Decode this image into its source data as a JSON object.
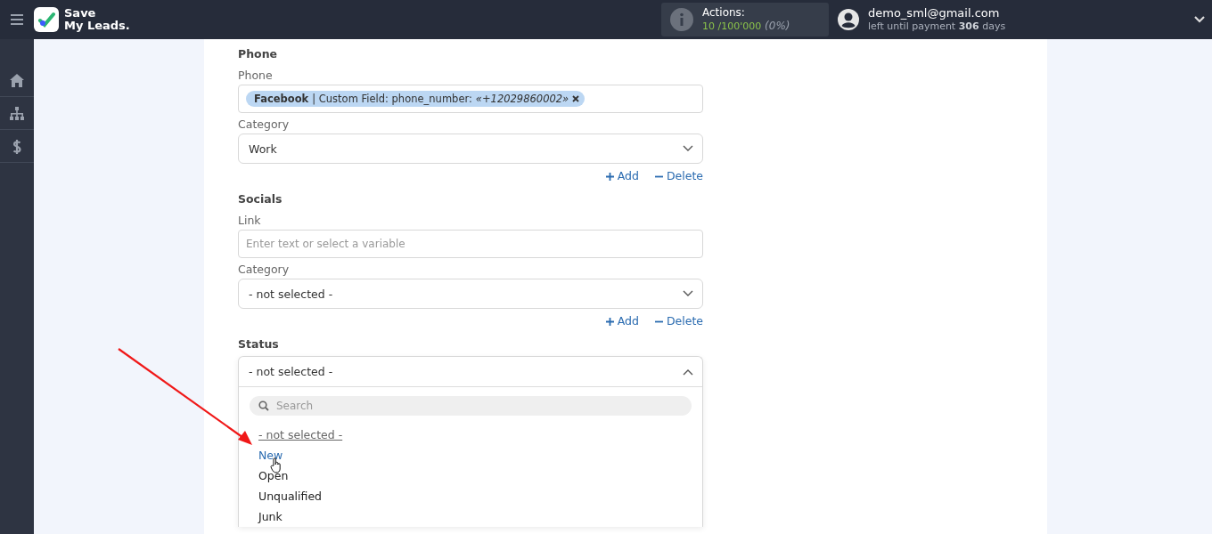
{
  "header": {
    "logo_line1": "Save",
    "logo_line2": "My Leads.",
    "actions_label": "Actions:",
    "actions_used": "10",
    "actions_total": "/100'000",
    "actions_percent": "(0%)",
    "email": "demo_sml@gmail.com",
    "payment_prefix": "left until payment",
    "payment_days": "306",
    "payment_suffix": "days"
  },
  "sidebar": {
    "items": [
      {
        "kind": "home"
      },
      {
        "kind": "sitemap"
      },
      {
        "kind": "dollar"
      }
    ]
  },
  "sections": [
    {
      "title": "Phone",
      "fields": [
        {
          "kind": "tags",
          "label": "Phone",
          "tag_source": "Facebook",
          "tag_text": "| Custom Field: phone_number:",
          "tag_value": "«+12029860002»"
        },
        {
          "kind": "select",
          "label": "Category",
          "value": "Work",
          "open": false
        }
      ],
      "add": "Add",
      "delete": "Delete"
    },
    {
      "title": "Socials",
      "fields": [
        {
          "kind": "input",
          "label": "Link",
          "placeholder": "Enter text or select a variable"
        },
        {
          "kind": "select",
          "label": "Category",
          "value": "- not selected -",
          "open": false
        }
      ],
      "add": "Add",
      "delete": "Delete"
    },
    {
      "title": "Status",
      "fields": [
        {
          "kind": "select",
          "value": "- not selected -",
          "open": true,
          "search_placeholder": "Search",
          "options": [
            {
              "label": "- not selected -",
              "selected": true,
              "highlighted": false
            },
            {
              "label": "New",
              "selected": false,
              "highlighted": true
            },
            {
              "label": "Open",
              "selected": false,
              "highlighted": false
            },
            {
              "label": "Unqualified",
              "selected": false,
              "highlighted": false
            },
            {
              "label": "Junk",
              "selected": false,
              "highlighted": false
            }
          ]
        }
      ]
    }
  ]
}
